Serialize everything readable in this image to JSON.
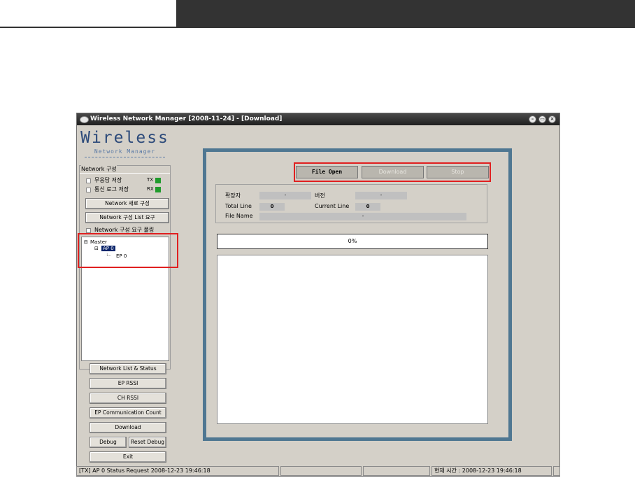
{
  "window": {
    "title": "Wireless Network Manager [2008-11-24] - [Download]",
    "controls": [
      "minimize-icon",
      "restore-icon",
      "close-icon"
    ]
  },
  "logo": {
    "main": "Wireless",
    "sub": "Network Manager"
  },
  "sidebar": {
    "group_title": "Network 구성",
    "checkbox_no_response": "무응답 저장",
    "checkbox_comm_log": "통신 로그 저장",
    "led_tx": "TX",
    "led_rx": "RX",
    "btn_new_config": "Network 새로 구성",
    "btn_config_list": "Network 구성 List 요구",
    "checkbox_polling": "Network 구성 요구 폴링",
    "tree": {
      "root": "Master",
      "ap": "AP 0",
      "ep": "EP 0"
    },
    "buttons": {
      "network_list": "Network List & Status",
      "ep_rssi": "EP RSSI",
      "ch_rssi": "CH RSSI",
      "ep_comm_count": "EP Communication Count",
      "download": "Download",
      "debug": "Debug",
      "reset_debug": "Reset Debug",
      "exit": "Exit"
    }
  },
  "download": {
    "file_open": "File Open",
    "download": "Download",
    "stop": "Stop",
    "ext_label": "확장자",
    "ext_value": "-",
    "version_label": "버전",
    "version_value": "-",
    "total_line_label": "Total Line",
    "total_line_value": "0",
    "current_line_label": "Current Line",
    "current_line_value": "0",
    "file_name_label": "File Name",
    "file_name_value": "-",
    "progress_text": "0%"
  },
  "status_bar": {
    "left": "[TX] AP 0  Status Request 2008-12-23 19:46:18",
    "right": "현재 시간 : 2008-12-23 19:46:18"
  },
  "colors": {
    "frame_blue": "#4f7792",
    "title_bg": "#2a2a2a",
    "highlight_red": "#e02020",
    "led_green": "#1f9b2c"
  }
}
